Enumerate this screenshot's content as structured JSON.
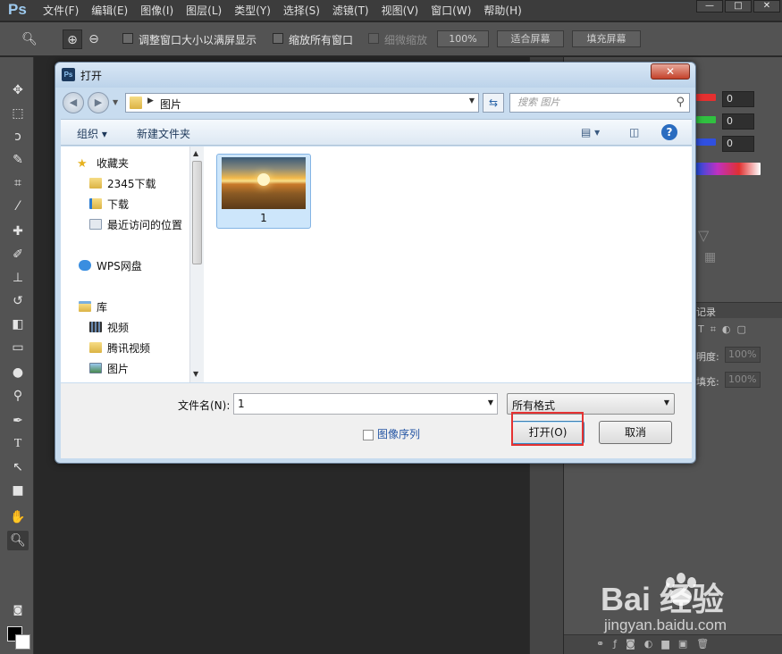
{
  "app": {
    "logo": "Ps"
  },
  "menu": [
    "文件(F)",
    "编辑(E)",
    "图像(I)",
    "图层(L)",
    "类型(Y)",
    "选择(S)",
    "滤镜(T)",
    "视图(V)",
    "窗口(W)",
    "帮助(H)"
  ],
  "window_controls": {
    "minimize": "—",
    "restore": "□",
    "close": "✕"
  },
  "options_bar": {
    "resize_windows": "调整窗口大小以满屏显示",
    "zoom_all": "缩放所有窗口",
    "scrubby_zoom": "细微缩放",
    "zoom_percent": "100%",
    "fit_screen": "适合屏幕",
    "fill_screen": "填充屏幕"
  },
  "right_panel": {
    "rgb_values": [
      "0",
      "0",
      "0"
    ],
    "history_tab": "记录",
    "opacity_label": "明度:",
    "opacity_value": "100%",
    "fill_label": "填充:",
    "fill_value": "100%"
  },
  "dialog": {
    "title": "打开",
    "close": "✕",
    "address": "图片",
    "search_placeholder": "搜索 图片",
    "commands": {
      "organize": "组织 ▾",
      "new_folder": "新建文件夹"
    },
    "nav": {
      "favorites": "收藏夹",
      "downloads_2345": "2345下载",
      "downloads": "下载",
      "recent": "最近访问的位置",
      "wps": "WPS网盘",
      "library": "库",
      "videos": "视频",
      "tencent_video": "腾讯视频",
      "pictures": "图片"
    },
    "files": [
      {
        "name": "1"
      }
    ],
    "filename_label": "文件名(N):",
    "filename_value": "1",
    "filetype_value": "所有格式",
    "image_sequence": "图像序列",
    "open_button": "打开(O)",
    "cancel_button": "取消"
  },
  "watermark": {
    "logo": "Bai  经验",
    "url": "jingyan.baidu.com"
  },
  "colors": {
    "highlight": "#e53232",
    "ps_blue": "#9ecbf0",
    "accent_link": "#2455a4"
  }
}
